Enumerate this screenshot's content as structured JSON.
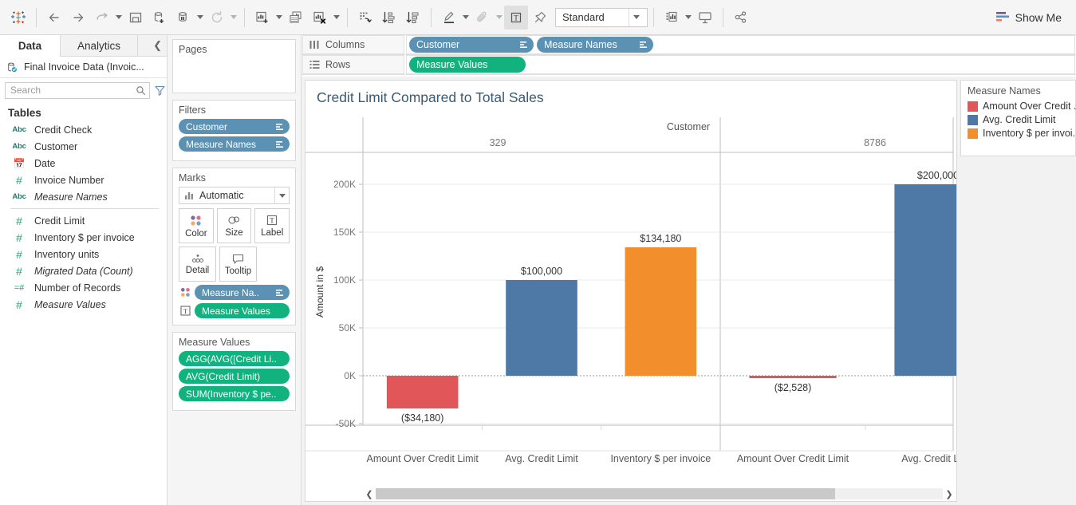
{
  "toolbar": {
    "logo_icon": "tableau-logo-icon",
    "items": [
      {
        "name": "back-button",
        "icon": "arrow-left-icon",
        "disabled": false
      },
      {
        "name": "forward-button",
        "icon": "arrow-right-icon",
        "disabled": false
      },
      {
        "name": "undo-redo-button",
        "icon": "undo-arrow-icon",
        "disabled": false
      },
      {
        "name": "save-button",
        "icon": "save-icon",
        "disabled": false
      },
      {
        "name": "new-data-source-button",
        "icon": "database-plus-icon",
        "disabled": false
      },
      {
        "name": "pause-auto-update-button",
        "icon": "database-pause-icon",
        "disabled": false
      },
      {
        "name": "refresh-button",
        "icon": "refresh-icon",
        "disabled": true
      },
      {
        "name": "new-worksheet-button",
        "icon": "chart-plus-icon",
        "disabled": false
      },
      {
        "name": "duplicate-sheet-button",
        "icon": "chart-duplicate-icon",
        "disabled": false
      },
      {
        "name": "clear-sheet-button",
        "icon": "chart-clear-icon",
        "disabled": false
      },
      {
        "name": "swap-rows-columns-button",
        "icon": "swap-axes-icon",
        "disabled": false
      },
      {
        "name": "sort-ascending-button",
        "icon": "sort-asc-icon",
        "disabled": false
      },
      {
        "name": "sort-descending-button",
        "icon": "sort-desc-icon",
        "disabled": false
      },
      {
        "name": "highlight-button",
        "icon": "highlighter-icon",
        "disabled": false
      },
      {
        "name": "group-members-button",
        "icon": "paperclip-icon",
        "disabled": true
      },
      {
        "name": "show-mark-labels-button",
        "icon": "text-label-icon",
        "disabled": false
      },
      {
        "name": "fix-axes-button",
        "icon": "pushpin-icon",
        "disabled": false
      },
      {
        "name": "show-hide-cards-button",
        "icon": "cards-icon",
        "disabled": false
      },
      {
        "name": "presentation-mode-button",
        "icon": "presentation-icon",
        "disabled": false
      },
      {
        "name": "share-workbook-button",
        "icon": "share-icon",
        "disabled": false
      }
    ],
    "fit_value": "Standard",
    "show_me_label": "Show Me",
    "show_me_icon": "show-me-icon"
  },
  "data_pane": {
    "tabs": [
      {
        "label": "Data",
        "selected": true
      },
      {
        "label": "Analytics",
        "selected": false
      }
    ],
    "collapse_icon": "chevron-left-icon",
    "datasource": {
      "label": "Final Invoice Data (Invoic...",
      "icon": "datasource-icon"
    },
    "search": {
      "placeholder": "Search",
      "value": "",
      "icon": "search-icon"
    },
    "filter_icon": "funnel-icon",
    "view_icon": "grid-view-icon",
    "view_caret_icon": "chevron-down-icon",
    "section_title": "Tables",
    "fields_group_1": [
      {
        "label": "Credit Check",
        "type": "Abc",
        "italic": false
      },
      {
        "label": "Customer",
        "type": "Abc",
        "italic": false
      },
      {
        "label": "Date",
        "type": "calendar",
        "italic": false
      },
      {
        "label": "Invoice Number",
        "type": "#",
        "italic": false
      },
      {
        "label": "Measure Names",
        "type": "Abc",
        "italic": true
      }
    ],
    "fields_group_2": [
      {
        "label": "Credit Limit",
        "type": "#",
        "italic": false
      },
      {
        "label": "Inventory $ per invoice",
        "type": "#",
        "italic": false
      },
      {
        "label": "Inventory units",
        "type": "#",
        "italic": false
      },
      {
        "label": "Migrated Data (Count)",
        "type": "#",
        "italic": true
      },
      {
        "label": "Number of Records",
        "type": "=#",
        "italic": false
      },
      {
        "label": "Measure Values",
        "type": "#",
        "italic": true
      }
    ]
  },
  "shelf_column": {
    "pages": {
      "title": "Pages",
      "pills": []
    },
    "filters": {
      "title": "Filters",
      "pills": [
        {
          "label": "Customer",
          "color": "blue",
          "icon": "filter-pill-icon"
        },
        {
          "label": "Measure Names",
          "color": "blue",
          "icon": "filter-pill-icon"
        }
      ]
    },
    "marks": {
      "title": "Marks",
      "mark_type": "Automatic",
      "mark_type_icon": "bar-chart-icon",
      "buttons": [
        {
          "label": "Color",
          "icon": "color-dots-icon"
        },
        {
          "label": "Size",
          "icon": "size-circles-icon"
        },
        {
          "label": "Label",
          "icon": "text-label-icon"
        },
        {
          "label": "Detail",
          "icon": "detail-dots-icon"
        },
        {
          "label": "Tooltip",
          "icon": "tooltip-icon"
        }
      ],
      "encodings": [
        {
          "icon": "color-dots-icon",
          "label": "Measure Na..",
          "color": "blue",
          "pill_icon": "filter-pill-icon"
        },
        {
          "icon": "text-label-icon",
          "label": "Measure Values",
          "color": "green",
          "pill_icon": ""
        }
      ]
    },
    "measure_values": {
      "title": "Measure Values",
      "pills": [
        {
          "label": "AGG(AVG([Credit Li..",
          "color": "green"
        },
        {
          "label": "AVG(Credit Limit)",
          "color": "green"
        },
        {
          "label": "SUM(Inventory $ pe..",
          "color": "green"
        }
      ]
    }
  },
  "worksheet": {
    "columns_shelf": {
      "label": "Columns",
      "icon": "columns-icon",
      "pills": [
        {
          "label": "Customer",
          "color": "blue",
          "icon": "filter-pill-icon"
        },
        {
          "label": "Measure Names",
          "color": "blue",
          "icon": "filter-pill-icon"
        }
      ]
    },
    "rows_shelf": {
      "label": "Rows",
      "icon": "rows-icon",
      "pills": [
        {
          "label": "Measure Values",
          "color": "green",
          "icon": ""
        }
      ]
    },
    "scrollbar": {
      "left_icon": "chevron-left-icon",
      "right_icon": "chevron-right-icon",
      "thumb_percent": 81
    }
  },
  "legend": {
    "title": "Measure Names",
    "items": [
      {
        "label": "Amount Over Credit ...",
        "color": "#e15759"
      },
      {
        "label": "Avg. Credit Limit",
        "color": "#4e79a7"
      },
      {
        "label": "Inventory $ per invoi...",
        "color": "#f28e2b"
      }
    ]
  },
  "chart_data": {
    "type": "bar",
    "title": "Credit Limit Compared to Total Sales",
    "xlabel": "Customer",
    "ylabel": "Amount in $",
    "ylim": [
      -50000,
      225000
    ],
    "yticks": [
      -50000,
      0,
      50000,
      100000,
      150000,
      200000
    ],
    "ytick_labels": [
      "-50K",
      "0K",
      "50K",
      "100K",
      "150K",
      "200K"
    ],
    "grid": true,
    "legend_position": "right",
    "column_header_label": "Customer",
    "groups": [
      {
        "name": "329",
        "bars": [
          {
            "category": "Amount Over Credit Limit",
            "value": -34180,
            "label": "($34,180)",
            "color": "#e15759"
          },
          {
            "category": "Avg. Credit Limit",
            "value": 100000,
            "label": "$100,000",
            "color": "#4e79a7"
          },
          {
            "category": "Inventory $ per invoice",
            "value": 134180,
            "label": "$134,180",
            "color": "#f28e2b"
          }
        ]
      },
      {
        "name": "8786",
        "bars": [
          {
            "category": "Amount Over Credit Limit",
            "value": -2528,
            "label": "($2,528)",
            "color": "#e15759"
          },
          {
            "category": "Avg. Credit Limit",
            "value": 200000,
            "label": "$200,000",
            "color": "#4e79a7"
          }
        ]
      }
    ]
  }
}
